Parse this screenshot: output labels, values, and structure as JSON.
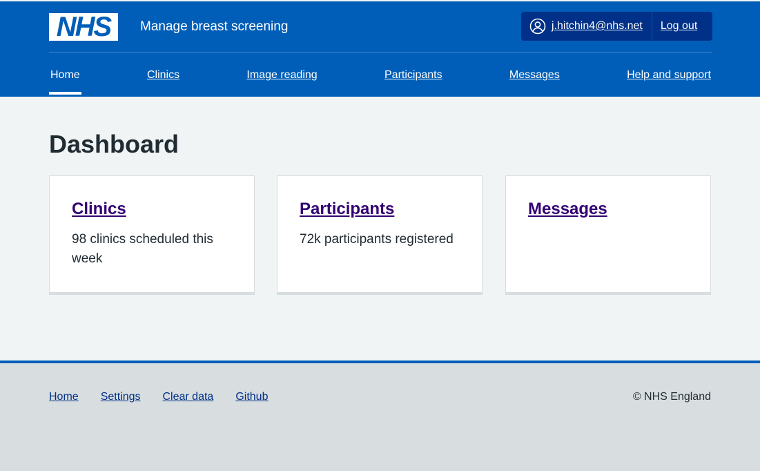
{
  "header": {
    "logo_text": "NHS",
    "service_name": "Manage breast screening",
    "account": {
      "user_email": "j.hitchin4@nhs.net",
      "logout_label": "Log out"
    }
  },
  "nav": {
    "items": [
      {
        "label": "Home",
        "current": true
      },
      {
        "label": "Clinics"
      },
      {
        "label": "Image reading"
      },
      {
        "label": "Participants"
      },
      {
        "label": "Messages"
      },
      {
        "label": "Help and support"
      }
    ]
  },
  "main": {
    "title": "Dashboard",
    "cards": [
      {
        "title": "Clinics",
        "description": "98 clinics scheduled this week"
      },
      {
        "title": "Participants",
        "description": "72k participants registered"
      },
      {
        "title": "Messages",
        "description": ""
      }
    ]
  },
  "footer": {
    "links": [
      "Home",
      "Settings",
      "Clear data",
      "Github"
    ],
    "copyright": "© NHS England"
  },
  "colors": {
    "nhs_blue": "#005eb8",
    "dark_blue": "#003087",
    "link_visited_purple": "#330072",
    "page_background": "#f0f4f5",
    "footer_background": "#d8dde0"
  },
  "icons": {
    "account": "user-circle-icon"
  }
}
